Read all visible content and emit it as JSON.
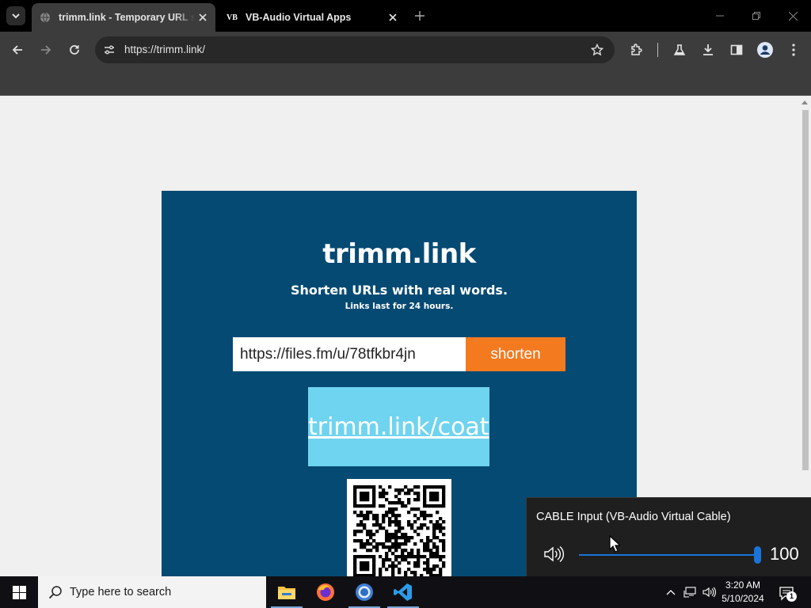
{
  "browser": {
    "tabs": [
      {
        "title": "trimm.link - Temporary URL sh",
        "active": true,
        "favicon": "globe-icon"
      },
      {
        "title": "VB-Audio Virtual Apps",
        "active": false,
        "favicon": "VB"
      }
    ],
    "address": "https://trimm.link/"
  },
  "page": {
    "logo": "trimm.link",
    "tagline": "Shorten URLs with real words.",
    "note": "Links last for 24 hours.",
    "input_value": "https://files.fm/u/78tfkbr4jn",
    "shorten_label": "shorten",
    "result_link": "trimm.link/coat",
    "colors": {
      "card": "#054a73",
      "button": "#f47a20",
      "result": "#6fd4ef"
    }
  },
  "volume_flyout": {
    "device": "CABLE Input (VB-Audio Virtual Cable)",
    "level": 100,
    "level_text": "100"
  },
  "taskbar": {
    "search_placeholder": "Type here to search",
    "time": "3:20 AM",
    "date": "5/10/2024",
    "notification_count": "1",
    "apps": [
      "file-explorer-icon",
      "firefox-icon",
      "chrome-icon",
      "vscode-icon"
    ]
  }
}
